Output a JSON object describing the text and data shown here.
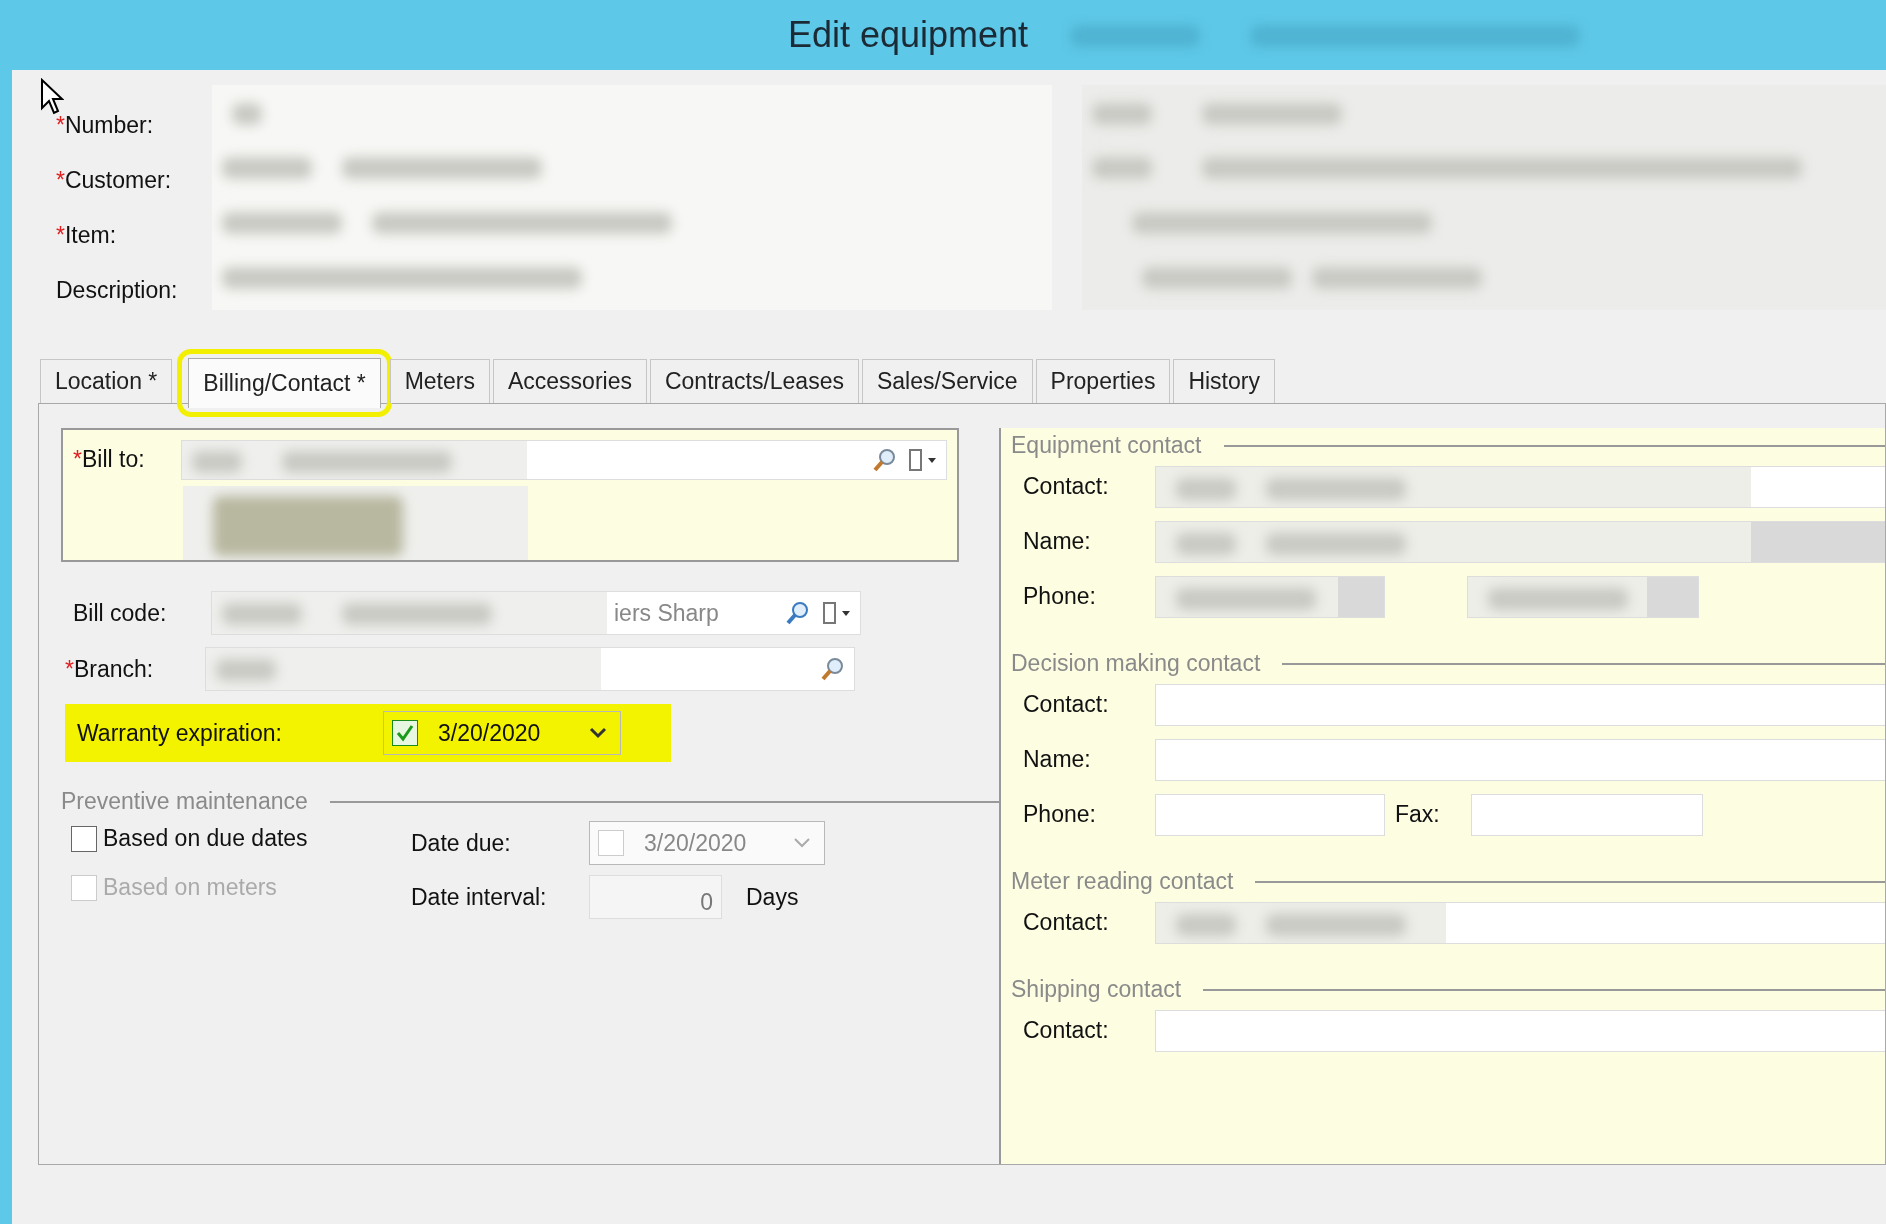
{
  "window": {
    "title": "Edit equipment"
  },
  "header_fields": [
    {
      "required_mark": "*",
      "label": "Number:"
    },
    {
      "required_mark": "*",
      "label": "Customer:"
    },
    {
      "required_mark": "*",
      "label": "Item:"
    },
    {
      "label": "Description:"
    }
  ],
  "tabs": [
    {
      "label": "Location *",
      "selected": false,
      "highlighted": false
    },
    {
      "label": "Billing/Contact *",
      "selected": true,
      "highlighted": true
    },
    {
      "label": "Meters",
      "selected": false,
      "highlighted": false
    },
    {
      "label": "Accessories",
      "selected": false,
      "highlighted": false
    },
    {
      "label": "Contracts/Leases",
      "selected": false,
      "highlighted": false
    },
    {
      "label": "Sales/Service",
      "selected": false,
      "highlighted": false
    },
    {
      "label": "Properties",
      "selected": false,
      "highlighted": false
    },
    {
      "label": "History",
      "selected": false,
      "highlighted": false
    }
  ],
  "billing": {
    "bill_to": {
      "required_mark": "*",
      "label": "Bill to:"
    },
    "bill_code": {
      "label": "Bill code:",
      "value": "iers Sharp"
    },
    "branch": {
      "required_mark": "*",
      "label": "Branch:"
    },
    "warranty": {
      "label": "Warranty expiration:",
      "checked": true,
      "value": "3/20/2020",
      "highlighted": true
    }
  },
  "preventive_maintenance": {
    "title": "Preventive maintenance",
    "options": [
      {
        "label": "Based on due dates",
        "checked": false,
        "disabled": false
      },
      {
        "label": "Based on meters",
        "checked": false,
        "disabled": true
      }
    ],
    "date_due": {
      "label": "Date due:",
      "checked": false,
      "value": "3/20/2020",
      "disabled": true
    },
    "date_interval": {
      "label": "Date interval:",
      "value": "0",
      "unit": "Days"
    }
  },
  "contact_groups": [
    {
      "title": "Equipment contact",
      "rows": [
        {
          "kind": "field",
          "label": "Contact:",
          "readonly": false,
          "redacted": true
        },
        {
          "kind": "field",
          "label": "Name:",
          "readonly": true,
          "redacted": true
        },
        {
          "kind": "phone",
          "label": "Phone:",
          "readonly": true,
          "redacted": true
        }
      ]
    },
    {
      "title": "Decision making contact",
      "rows": [
        {
          "kind": "field",
          "label": "Contact:",
          "readonly": false
        },
        {
          "kind": "field",
          "label": "Name:",
          "readonly": false
        },
        {
          "kind": "phone",
          "label": "Phone:",
          "fax_label": "Fax:",
          "readonly": false
        }
      ]
    },
    {
      "title": "Meter reading contact",
      "rows": [
        {
          "kind": "field",
          "label": "Contact:",
          "readonly": false,
          "redacted": true
        }
      ]
    },
    {
      "title": "Shipping contact",
      "rows": [
        {
          "kind": "field",
          "label": "Contact:",
          "readonly": false
        }
      ]
    }
  ]
}
